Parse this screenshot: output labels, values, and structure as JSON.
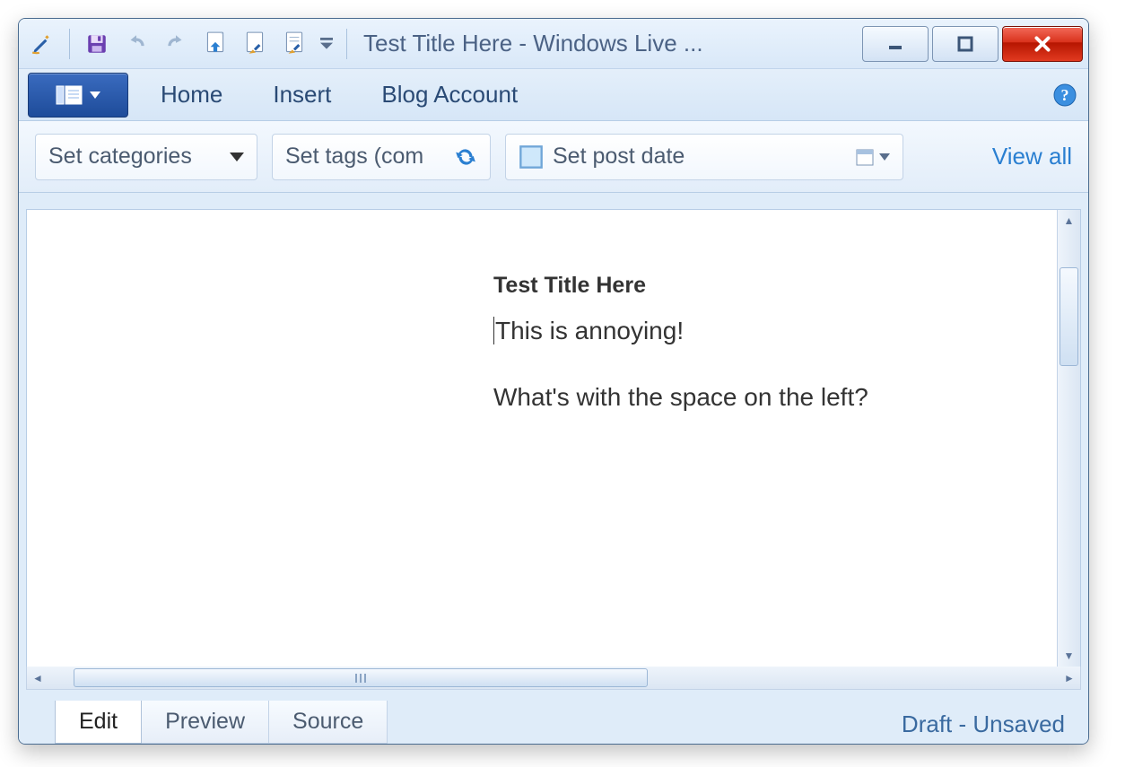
{
  "window": {
    "title": "Test Title Here - Windows Live ..."
  },
  "ribbon": {
    "tabs": [
      "Home",
      "Insert",
      "Blog Account"
    ]
  },
  "toolbar": {
    "categories_label": "Set categories",
    "tags_placeholder": "Set tags (com",
    "date_placeholder": "Set post date",
    "view_all": "View all"
  },
  "document": {
    "title": "Test Title Here",
    "line1": "This is annoying!",
    "line2": "What's with the space on the left?"
  },
  "bottom_tabs": {
    "edit": "Edit",
    "preview": "Preview",
    "source": "Source"
  },
  "status": "Draft - Unsaved",
  "colors": {
    "ribbon_bg": "#d6e6f7",
    "file_menu": "#1e4c9a",
    "link": "#2a7fd1",
    "close": "#d9321c"
  }
}
